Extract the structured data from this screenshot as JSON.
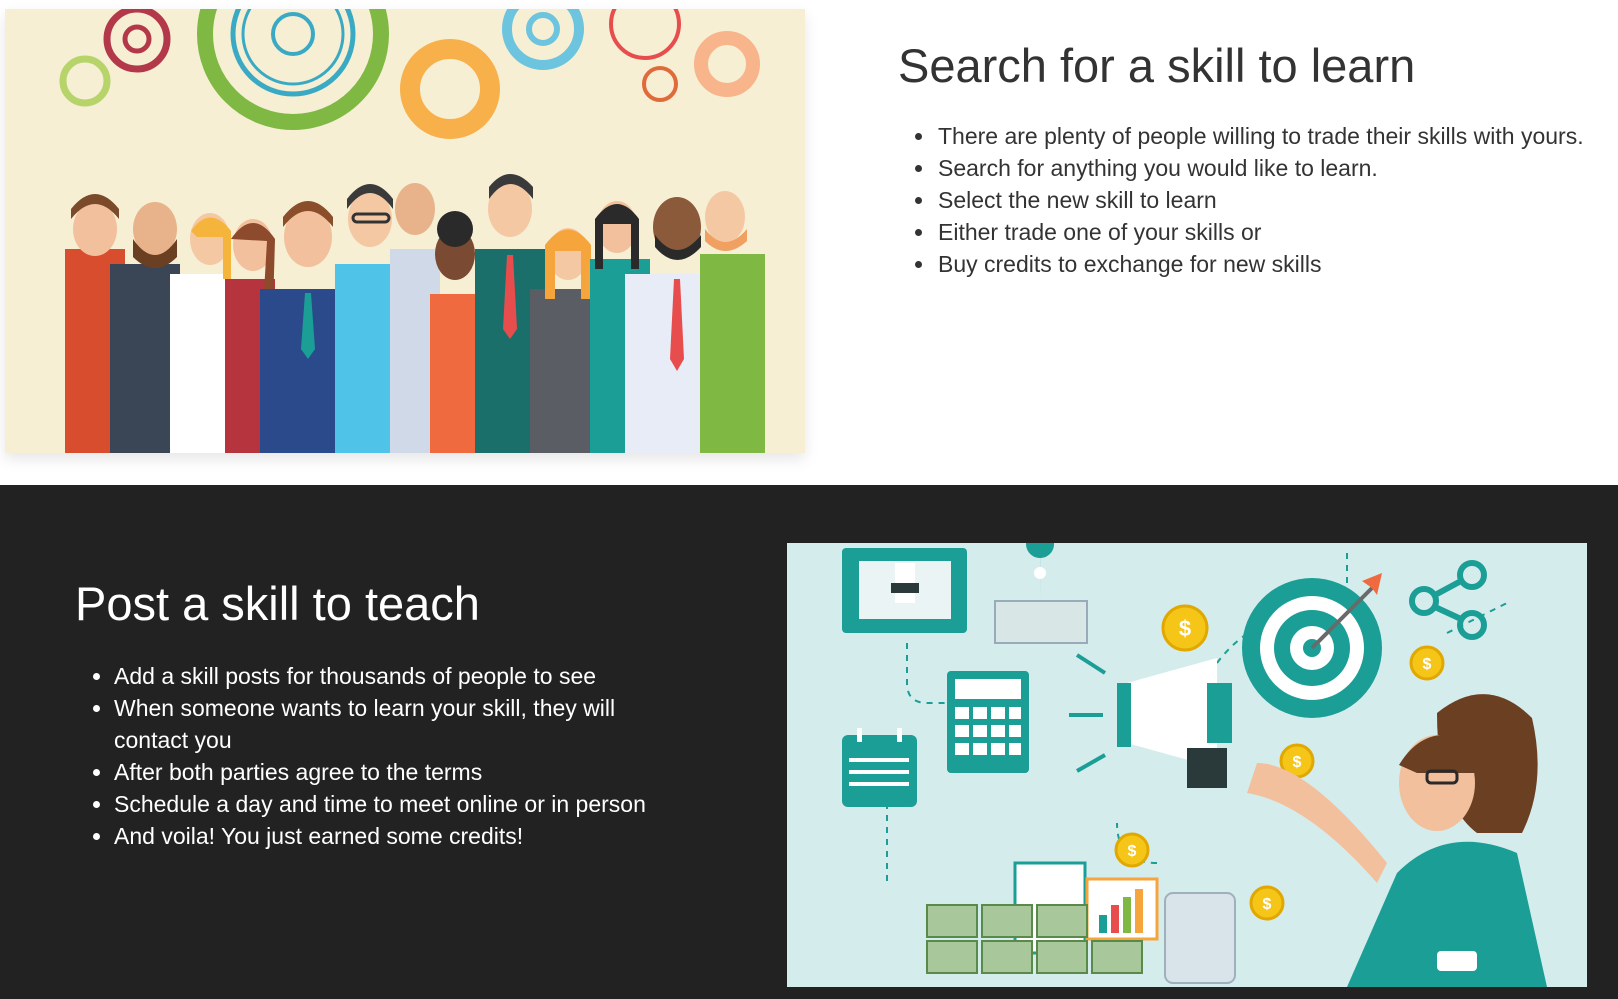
{
  "search_section": {
    "title": "Search for a skill to learn",
    "bullets": [
      "There are plenty of people willing to trade their skills with yours.",
      "Search for anything you would like to learn.",
      "Select the new skill to learn",
      "Either trade one of your skills or",
      "Buy credits to exchange for new skills"
    ],
    "image": "people-and-gears-illustration"
  },
  "post_section": {
    "title": "Post a skill to teach",
    "bullets": [
      "Add a skill posts for thousands of people to see",
      "When someone wants to learn your skill, they will contact you",
      "After both parties agree to the terms",
      "Schedule a day and time to meet online or in person",
      "And voila! You just earned some credits!"
    ],
    "image": "marketing-megaphone-illustration",
    "coin_symbol": "$"
  },
  "colors": {
    "dark_background": "#222222",
    "light_text": "#ffffff",
    "dark_text": "#333333",
    "illustration_cream": "#f6efd4",
    "illustration_mint": "#d5ecec",
    "teal": "#1a9e96"
  }
}
